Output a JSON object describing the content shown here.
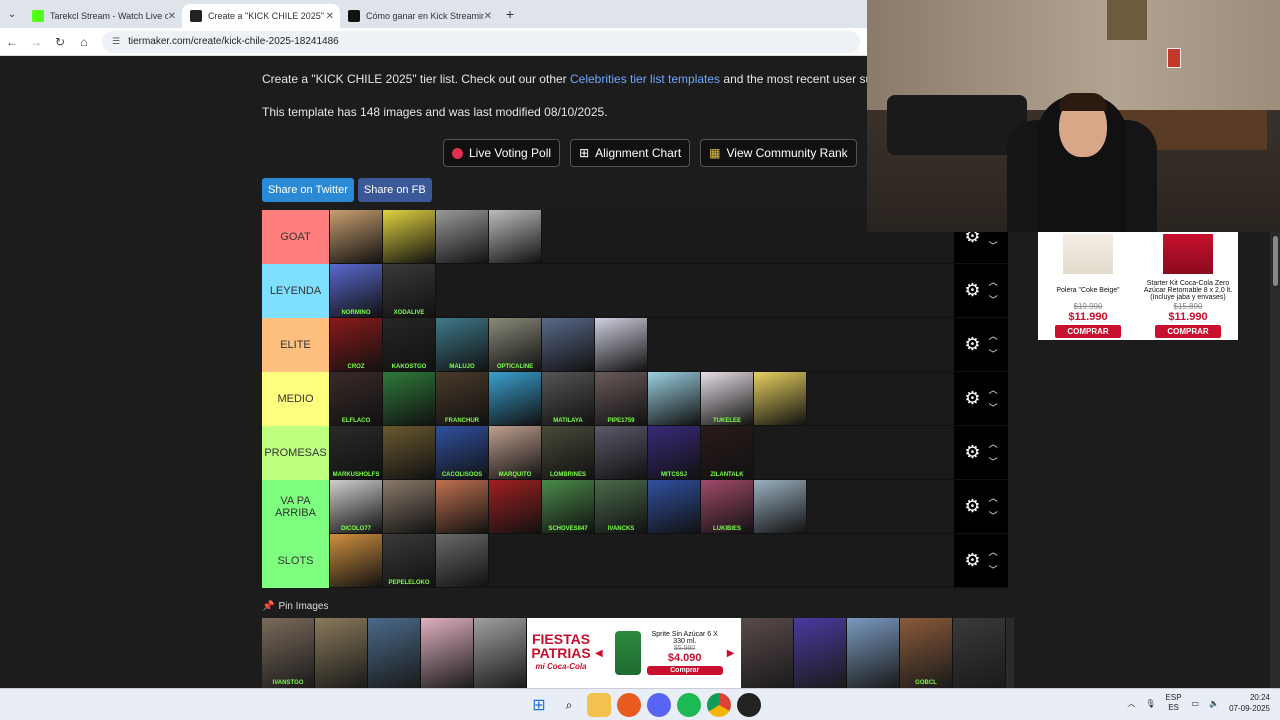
{
  "browser": {
    "tabs": [
      {
        "label": "Tarekcl Stream - Watch Live on",
        "color": "#53fc18"
      },
      {
        "label": "Create a \"KICK CHILE 2025\" Tier",
        "color": "#222222"
      },
      {
        "label": "Cómo ganar en Kick Streaming",
        "color": "#111111"
      }
    ],
    "url": "tiermaker.com/create/kick-chile-2025-18241486"
  },
  "page": {
    "intro_prefix": "Create a \"KICK CHILE 2025\" tier list. Check out our other ",
    "intro_link": "Celebrities tier list templates",
    "intro_suffix": " and the most recent user submitte",
    "info": "This template has 148 images and was last modified 08/10/2025.",
    "buttons": {
      "voting": "Live Voting Poll",
      "alignment": "Alignment Chart",
      "rank": "View Community Rank"
    },
    "share": {
      "twitter": "Share on Twitter",
      "fb": "Share on FB"
    },
    "pin_images": "Pin Images"
  },
  "tiers": [
    {
      "label": "GOAT",
      "color": "#ff7f7f",
      "items": [
        {
          "name": "",
          "color": "#c9a070"
        },
        {
          "name": "",
          "color": "#e2d340"
        },
        {
          "name": "",
          "color": "#9a9a9a"
        },
        {
          "name": "",
          "color": "#bdbdbd"
        }
      ]
    },
    {
      "label": "LEYENDA",
      "color": "#7fdfff",
      "items": [
        {
          "name": "NORMINO",
          "color": "#5a6ad0"
        },
        {
          "name": "XODALIVE",
          "color": "#3a3a3a"
        }
      ]
    },
    {
      "label": "ELITE",
      "color": "#ffbf7f",
      "items": [
        {
          "name": "CROZ",
          "color": "#8b1a1a"
        },
        {
          "name": "KAKOSTGO",
          "color": "#262626"
        },
        {
          "name": "MALUJO",
          "color": "#3f7a8a"
        },
        {
          "name": "OPTICALINE",
          "color": "#8a8a7a"
        },
        {
          "name": "",
          "color": "#5a6a8a"
        },
        {
          "name": "",
          "color": "#d0d0e0"
        }
      ]
    },
    {
      "label": "MEDIO",
      "color": "#ffff7f",
      "items": [
        {
          "name": "ELFLACO",
          "color": "#3a2a2a"
        },
        {
          "name": "",
          "color": "#2f7a3a"
        },
        {
          "name": "FRANCHUR",
          "color": "#4a3a2a"
        },
        {
          "name": "",
          "color": "#3aa0d0"
        },
        {
          "name": "MATILAYA",
          "color": "#555555"
        },
        {
          "name": "PIPE1759",
          "color": "#6a5a5a"
        },
        {
          "name": "",
          "color": "#9ad0e0"
        },
        {
          "name": "TUKELEE",
          "color": "#e8e0e8"
        },
        {
          "name": "",
          "color": "#e8d060"
        }
      ]
    },
    {
      "label": "PROMESAS",
      "color": "#bfff7f",
      "items": [
        {
          "name": "MARKUSHOLFS",
          "color": "#2a2a2a"
        },
        {
          "name": "",
          "color": "#6a5a30"
        },
        {
          "name": "CACOLISOOS",
          "color": "#3050a0"
        },
        {
          "name": "MARQUITO",
          "color": "#c0a090"
        },
        {
          "name": "LOMBRINES",
          "color": "#4a4a3a"
        },
        {
          "name": "",
          "color": "#5a5a6a"
        },
        {
          "name": "MITCSSJ",
          "color": "#3a2a7a"
        },
        {
          "name": "ZILANTALK",
          "color": "#2a1a1a"
        }
      ]
    },
    {
      "label": "VA PA ARRIBA",
      "color": "#7fff7f",
      "items": [
        {
          "name": "DICOLO77",
          "color": "#d0d0d0"
        },
        {
          "name": "",
          "color": "#8a7a6a"
        },
        {
          "name": "",
          "color": "#c07050"
        },
        {
          "name": "",
          "color": "#a02020"
        },
        {
          "name": "SCHOVES847",
          "color": "#4a8a4a"
        },
        {
          "name": "IVANCKS",
          "color": "#4a6a4a"
        },
        {
          "name": "",
          "color": "#3050a0"
        },
        {
          "name": "LUKIBIES",
          "color": "#a04a6a"
        },
        {
          "name": "",
          "color": "#9ab0c0"
        }
      ]
    },
    {
      "label": "SLOTS",
      "color": "#7fff7f",
      "items": [
        {
          "name": "",
          "color": "#d09040"
        },
        {
          "name": "PEPELELOKO",
          "color": "#3a3a3a"
        },
        {
          "name": "",
          "color": "#6a6a6a"
        }
      ]
    }
  ],
  "pool": {
    "left": [
      {
        "name": "IVANSTGO",
        "color": "#7a6a5a"
      },
      {
        "name": "",
        "color": "#8a7a5a"
      },
      {
        "name": "",
        "color": "#4a6a8a"
      },
      {
        "name": "",
        "color": "#e0b0c0"
      },
      {
        "name": "",
        "color": "#a0a0a0"
      }
    ],
    "right": [
      {
        "name": "",
        "color": "#5a4a4a"
      },
      {
        "name": "",
        "color": "#4a3aa0"
      },
      {
        "name": "",
        "color": "#7a9ac0"
      },
      {
        "name": "GOBCL",
        "color": "#8a5a3a"
      },
      {
        "name": "",
        "color": "#3a3a3a"
      }
    ],
    "ad": {
      "brand_line1": "FIESTAS",
      "brand_line2": "PATRIAS",
      "brand_tag": "mi Coca-Cola",
      "product": "Sprite Sin Azúcar 6 X 330 ml.",
      "old_price": "$5.990",
      "new_price": "$4.090",
      "buy": "Comprar"
    }
  },
  "side_ad": {
    "items": [
      {
        "title": "Polera \"Coke Beige\"",
        "old": "$19.990",
        "new": "$11.990",
        "buy": "COMPRAR"
      },
      {
        "title": "Starter Kit Coca-Cola Zero Azúcar Retornable 8 x 2,0 lt. (Incluye jaba y envases)",
        "old": "$15.890",
        "new": "$11.990",
        "buy": "COMPRAR"
      }
    ]
  },
  "taskbar": {
    "lang1": "ESP",
    "lang2": "ES",
    "time": "20:24",
    "date": "07-09-2025"
  }
}
